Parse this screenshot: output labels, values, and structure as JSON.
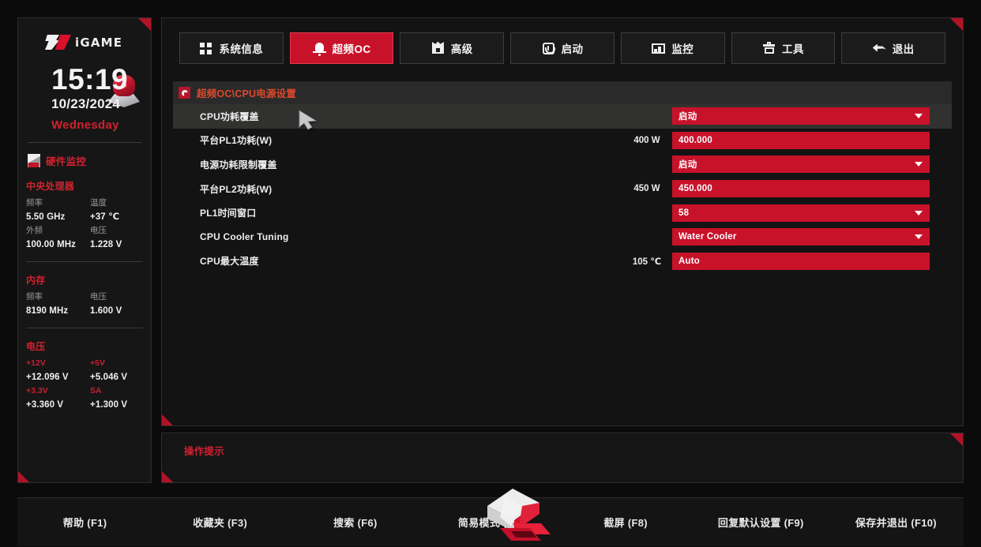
{
  "sidebar": {
    "brand": "iGAME",
    "clock": "15:19",
    "date": "10/23/2024",
    "weekday": "Wednesday",
    "hardware_monitor": {
      "title": "硬件监控",
      "groups": [
        {
          "name": "中央处理器",
          "entries": [
            {
              "key": "频率",
              "value": "5.50 GHz"
            },
            {
              "key": "温度",
              "value": "+37 ℃"
            },
            {
              "key": "外频",
              "value": "100.00 MHz"
            },
            {
              "key": "电压",
              "value": "1.228 V"
            }
          ]
        },
        {
          "name": "内存",
          "entries": [
            {
              "key": "频率",
              "value": "8190 MHz"
            },
            {
              "key": "电压",
              "value": "1.600 V"
            }
          ]
        },
        {
          "name": "电压",
          "entries": [
            {
              "key": "+12V",
              "value": "+12.096 V"
            },
            {
              "key": "+5V",
              "value": "+5.046 V"
            },
            {
              "key": "+3.3V",
              "value": "+3.360 V"
            },
            {
              "key": "SA",
              "value": "+1.300 V"
            }
          ]
        }
      ]
    }
  },
  "tabs": [
    {
      "label": "系统信息",
      "icon": "grid-icon",
      "active": false
    },
    {
      "label": "超频OC",
      "icon": "overclock-icon",
      "active": true
    },
    {
      "label": "高级",
      "icon": "chip-icon",
      "active": false
    },
    {
      "label": "启动",
      "icon": "power-icon",
      "active": false
    },
    {
      "label": "监控",
      "icon": "monitor-icon",
      "active": false
    },
    {
      "label": "工具",
      "icon": "toolbox-icon",
      "active": false
    },
    {
      "label": "退出",
      "icon": "exit-arrow-icon",
      "active": false
    }
  ],
  "breadcrumb": "超频OC\\CPU电源设置",
  "settings": [
    {
      "label": "CPU功耗覆盖",
      "hint": "",
      "value": "启动",
      "control": "dropdown",
      "selected": true
    },
    {
      "label": "平台PL1功耗(W)",
      "hint": "400 W",
      "value": "400.000",
      "control": "input",
      "selected": false
    },
    {
      "label": "电源功耗限制覆盖",
      "hint": "",
      "value": "启动",
      "control": "dropdown",
      "selected": false
    },
    {
      "label": "平台PL2功耗(W)",
      "hint": "450 W",
      "value": "450.000",
      "control": "input",
      "selected": false
    },
    {
      "label": "PL1时间窗口",
      "hint": "",
      "value": "58",
      "control": "dropdown",
      "selected": false
    },
    {
      "label": "CPU Cooler Tuning",
      "hint": "",
      "value": "Water Cooler",
      "control": "dropdown",
      "selected": false
    },
    {
      "label": "CPU最大温度",
      "hint": "105 ℃",
      "value": "Auto",
      "control": "input",
      "selected": false
    }
  ],
  "hint_panel": {
    "title": "操作提示",
    "body": ""
  },
  "footer_keys": [
    "帮助 (F1)",
    "收藏夹 (F3)",
    "搜索 (F6)",
    "简易模式 (F7)",
    "截屏 (F8)",
    "回复默认设置 (F9)",
    "保存并退出 (F10)"
  ],
  "colors": {
    "accent_red": "#c8122a",
    "title_red": "#cf2230",
    "breadcrumb_orange": "#e0472c",
    "panel_bg": "#131313",
    "row_selected": "#313130"
  }
}
